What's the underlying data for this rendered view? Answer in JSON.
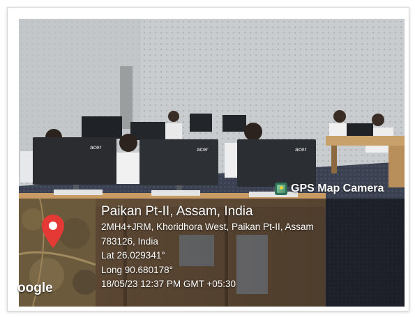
{
  "overlay": {
    "app_label": "GPS Map Camera",
    "app_icon": "gps-map-camera-icon",
    "place": "Paikan Pt-II, Assam, India",
    "address_line1": "2MH4+JRM, Khoridhora West, Paikan Pt-II, Assam",
    "address_line2": "783126, India",
    "latitude": "Lat 26.029341°",
    "longitude": "Long 90.680178°",
    "timestamp": "18/05/23 12:37 PM GMT +05:30",
    "map_brand": "oogle"
  },
  "colors": {
    "pin": "#e53935",
    "panel": "#141418",
    "wall": "#cdd0d2",
    "monitor": "#2a2c30"
  },
  "monitor_logos": [
    "acer",
    "acer",
    "acer"
  ]
}
